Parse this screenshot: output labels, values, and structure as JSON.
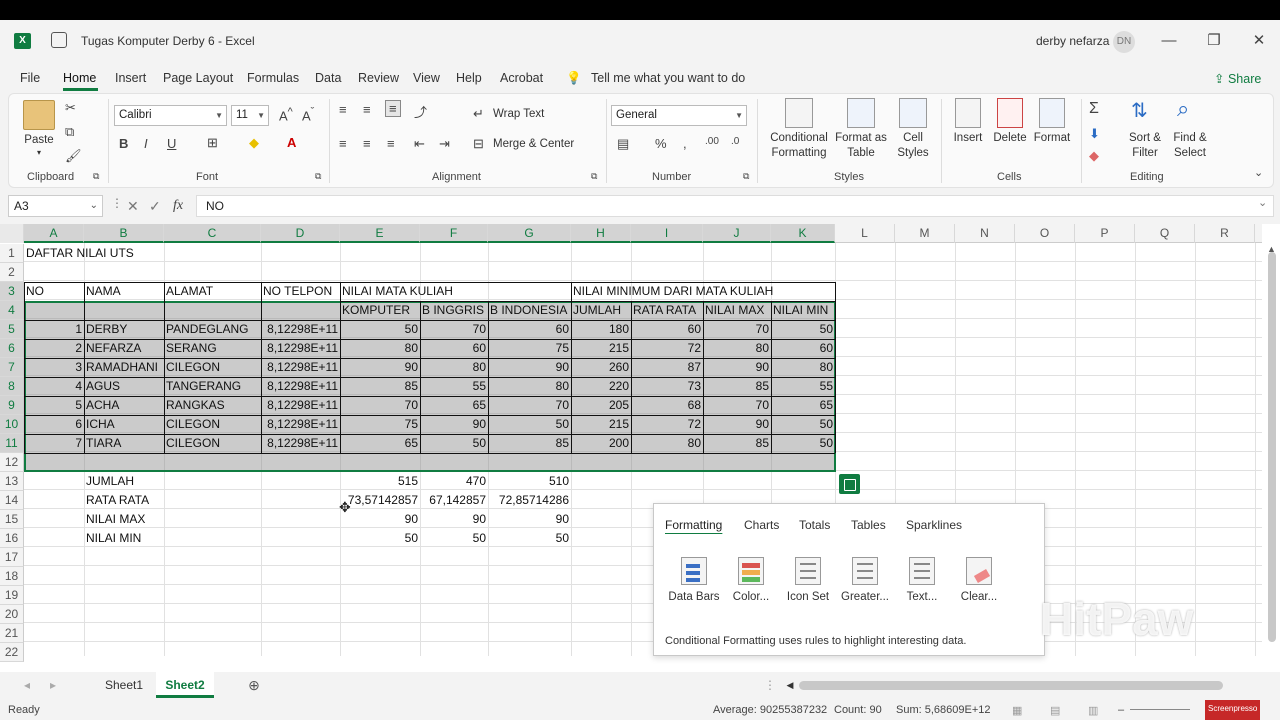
{
  "window": {
    "title": "Tugas Komputer Derby 6  -  Excel",
    "user": "derby nefarza",
    "avatar": "DN"
  },
  "menu": [
    "File",
    "Home",
    "Insert",
    "Page Layout",
    "Formulas",
    "Data",
    "Review",
    "View",
    "Help",
    "Acrobat"
  ],
  "tell_me": "Tell me what you want to do",
  "share": "Share",
  "ribbon": {
    "clipboard": {
      "label": "Clipboard",
      "paste": "Paste"
    },
    "font": {
      "label": "Font",
      "name": "Calibri",
      "size": "11"
    },
    "alignment": {
      "label": "Alignment",
      "wrap": "Wrap Text",
      "merge": "Merge & Center"
    },
    "number": {
      "label": "Number",
      "format": "General"
    },
    "styles": {
      "label": "Styles",
      "cond1": "Conditional",
      "cond2": "Formatting",
      "fmt1": "Format as",
      "fmt2": "Table",
      "cell1": "Cell",
      "cell2": "Styles"
    },
    "cells": {
      "label": "Cells",
      "insert": "Insert",
      "delete": "Delete",
      "format": "Format"
    },
    "editing": {
      "label": "Editing",
      "sort1": "Sort &",
      "sort2": "Filter",
      "find1": "Find &",
      "find2": "Select"
    }
  },
  "formula": {
    "name_box": "A3",
    "content": "NO"
  },
  "columns": [
    "A",
    "B",
    "C",
    "D",
    "E",
    "F",
    "G",
    "H",
    "I",
    "J",
    "K",
    "L",
    "M",
    "N",
    "O",
    "P",
    "Q",
    "R"
  ],
  "rows": [
    "1",
    "2",
    "3",
    "4",
    "5",
    "6",
    "7",
    "8",
    "9",
    "10",
    "11",
    "12",
    "13",
    "14",
    "15",
    "16",
    "17",
    "18",
    "19",
    "20",
    "21",
    "22"
  ],
  "cells": {
    "a1": "DAFTAR NILAI UTS",
    "header3": [
      "NO",
      "NAMA",
      "ALAMAT",
      "NO TELPON",
      "NILAI MATA KULIAH",
      "NILAI MINIMUM DARI MATA KULIAH"
    ],
    "header4": [
      "KOMPUTER",
      "B INGGRIS",
      "B INDONESIA",
      "JUMLAH",
      "RATA RATA",
      "NILAI MAX",
      "NILAI MIN"
    ],
    "data": [
      [
        "1",
        "DERBY",
        "PANDEGLANG",
        "8,12298E+11",
        "50",
        "70",
        "60",
        "180",
        "60",
        "70",
        "50"
      ],
      [
        "2",
        "NEFARZA",
        "SERANG",
        "8,12298E+11",
        "80",
        "60",
        "75",
        "215",
        "72",
        "80",
        "60"
      ],
      [
        "3",
        "RAMADHANI",
        "CILEGON",
        "8,12298E+11",
        "90",
        "80",
        "90",
        "260",
        "87",
        "90",
        "80"
      ],
      [
        "4",
        "AGUS",
        "TANGERANG",
        "8,12298E+11",
        "85",
        "55",
        "80",
        "220",
        "73",
        "85",
        "55"
      ],
      [
        "5",
        "ACHA",
        "RANGKAS",
        "8,12298E+11",
        "70",
        "65",
        "70",
        "205",
        "68",
        "70",
        "65"
      ],
      [
        "6",
        "ICHA",
        "CILEGON",
        "8,12298E+11",
        "75",
        "90",
        "50",
        "215",
        "72",
        "90",
        "50"
      ],
      [
        "7",
        "TIARA",
        "CILEGON",
        "8,12298E+11",
        "65",
        "50",
        "85",
        "200",
        "80",
        "85",
        "50"
      ]
    ],
    "summary": [
      [
        "JUMLAH",
        "515",
        "470",
        "510"
      ],
      [
        "RATA RATA",
        "73,57142857",
        "67,142857",
        "72,85714286"
      ],
      [
        "NILAI MAX",
        "90",
        "90",
        "90"
      ],
      [
        "NILAI MIN",
        "50",
        "50",
        "50"
      ]
    ]
  },
  "quick_analysis": {
    "tabs": [
      "Formatting",
      "Charts",
      "Totals",
      "Tables",
      "Sparklines"
    ],
    "items": [
      "Data Bars",
      "Color...",
      "Icon Set",
      "Greater...",
      "Text...",
      "Clear..."
    ],
    "description": "Conditional Formatting uses rules to highlight interesting data."
  },
  "sheets": [
    "Sheet1",
    "Sheet2"
  ],
  "status": {
    "ready": "Ready",
    "average": "Average: 90255387232",
    "count": "Count: 90",
    "sum": "Sum: 5,68609E+12"
  },
  "watermark": "HitPaw",
  "badge": "Screenpresso"
}
